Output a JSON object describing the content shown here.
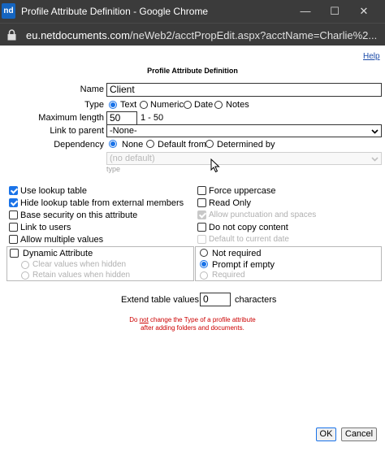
{
  "window": {
    "app_icon": "nd",
    "title": "Profile Attribute Definition - Google Chrome",
    "minimize": "—",
    "maximize": "☐",
    "close": "✕"
  },
  "addressbar": {
    "domain": "eu.netdocuments.com",
    "path": "/neWeb2/acctPropEdit.aspx?acctName=Charlie%2..."
  },
  "page": {
    "help": "Help",
    "title": "Profile Attribute Definition"
  },
  "form": {
    "name_label": "Name",
    "name_value": "Client",
    "type_label": "Type",
    "type_options": [
      "Text",
      "Numeric",
      "Date",
      "Notes"
    ],
    "type_selected": "Text",
    "maxlen_label": "Maximum length",
    "maxlen_value": "50",
    "maxlen_range": "1 - 50",
    "link_label": "Link to parent",
    "link_value": "-None-",
    "dependency_label": "Dependency",
    "dependency_options": [
      "None",
      "Default from",
      "Determined by"
    ],
    "dependency_selected": "None",
    "default_select": "(no default)",
    "type_hint": "type"
  },
  "options_left": [
    {
      "label": "Use lookup table",
      "checked": true
    },
    {
      "label": "Hide lookup table from external members",
      "checked": true
    },
    {
      "label": "Base security on this attribute",
      "checked": false
    },
    {
      "label": "Link to users",
      "checked": false
    },
    {
      "label": "Allow multiple values",
      "checked": false
    }
  ],
  "options_right": [
    {
      "label": "Force uppercase",
      "checked": false,
      "disabled": false
    },
    {
      "label": "Read Only",
      "checked": false,
      "disabled": false
    },
    {
      "label": "Allow punctuation and spaces",
      "checked": true,
      "disabled": true
    },
    {
      "label": "Do not copy content",
      "checked": false,
      "disabled": false
    },
    {
      "label": "Default to current date",
      "checked": false,
      "disabled": true
    }
  ],
  "dynamic": {
    "label": "Dynamic Attribute",
    "clear": "Clear values when hidden",
    "retain": "Retain values when hidden"
  },
  "required": {
    "not_required": "Not required",
    "prompt": "Prompt if empty",
    "required": "Required",
    "selected": "Prompt if empty"
  },
  "extend": {
    "label": "Extend table values to",
    "value": "0",
    "unit": "characters"
  },
  "note": {
    "before": "Do ",
    "emph": "not",
    "after": " change the Type of a profile attribute",
    "line2": "after adding folders and documents."
  },
  "buttons": {
    "ok": "OK",
    "cancel": "Cancel"
  }
}
